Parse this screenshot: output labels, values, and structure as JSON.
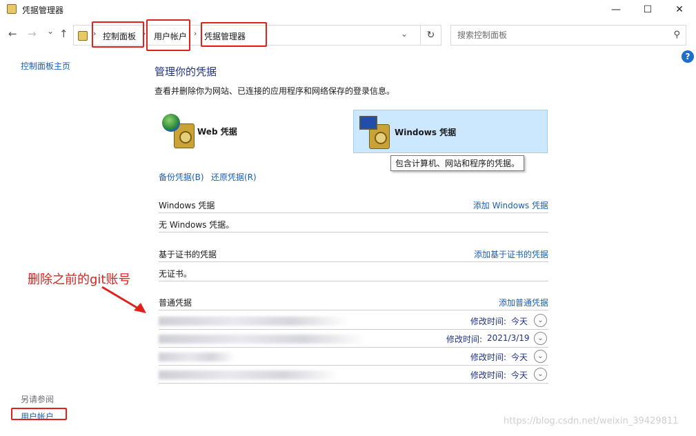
{
  "window": {
    "title": "凭据管理器",
    "minimize": "—",
    "maximize": "☐",
    "close": "✕"
  },
  "nav": {
    "back": "←",
    "forward": "→",
    "recent": "⌄",
    "up": "↑",
    "breadcrumbs": [
      "控制面板",
      "用户帐户",
      "凭据管理器"
    ],
    "separator": "›",
    "dropdown": "⌄",
    "refresh": "↻",
    "search_placeholder": "搜索控制面板"
  },
  "help": "?",
  "sidebar": {
    "home": "控制面板主页",
    "see_also": "另请参阅",
    "user_accounts": "用户帐户"
  },
  "main": {
    "title": "管理你的凭据",
    "description": "查看并删除你为网站、已连接的应用程序和网络保存的登录信息。",
    "tiles": {
      "web": "Web 凭据",
      "windows": "Windows 凭据"
    },
    "tooltip": "包含计算机、网站和程序的凭据。",
    "backup": "备份凭据(B)",
    "restore": "还原凭据(R)",
    "windows_section": {
      "name": "Windows 凭据",
      "add": "添加 Windows 凭据",
      "empty": "无 Windows 凭据。"
    },
    "cert_section": {
      "name": "基于证书的凭据",
      "add": "添加基于证书的凭据",
      "empty": "无证书。"
    },
    "generic_section": {
      "name": "普通凭据",
      "add": "添加普通凭据",
      "rows": [
        {
          "label": "修改时间:",
          "value": "今天"
        },
        {
          "label": "修改时间:",
          "value": "2021/3/19"
        },
        {
          "label": "修改时间:",
          "value": "今天"
        },
        {
          "label": "修改时间:",
          "value": "今天"
        }
      ]
    }
  },
  "annotation": "删除之前的git账号",
  "watermark": "https://blog.csdn.net/weixin_39429811",
  "colors": {
    "accent_red": "#e0201c",
    "link": "#1a5fb4",
    "selected_tile": "#cce8ff"
  }
}
